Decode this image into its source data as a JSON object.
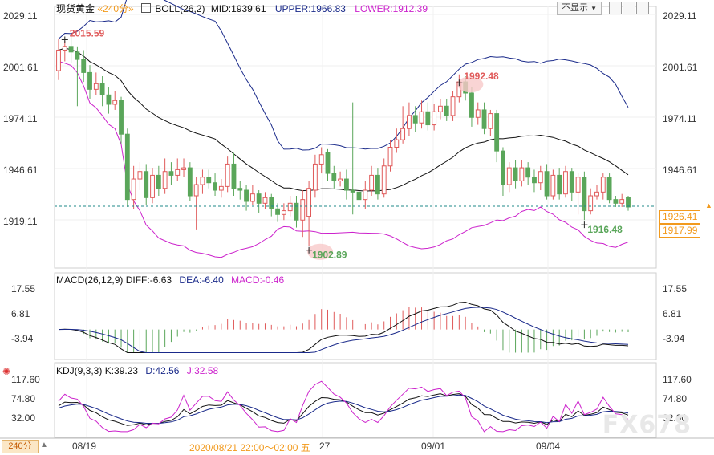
{
  "header": {
    "instrument": "现货黄金",
    "period": "«240分»",
    "boll_label": "BOLL(26,2)",
    "mid": "MID:1939.61",
    "upper": "UPPER:1966.83",
    "lower": "LOWER:1912.39",
    "restore_button": "不显示"
  },
  "macd_header": {
    "name": "MACD(26,12,9)",
    "diff": "DIFF:-6.63",
    "dea": "DEA:-6.40",
    "macd": "MACD:-0.46"
  },
  "kdj_header": {
    "name": "KDJ(9,3,3)",
    "k": "K:39.23",
    "d": "D:42.56",
    "j": "J:32.58"
  },
  "footer": {
    "period_button": "240分",
    "date_1": "08/19",
    "hover_time": "2020/08/21 22:00～02:00 五",
    "date_2": "27",
    "date_3": "09/01",
    "date_4": "09/04"
  },
  "price_axis": [
    "2029.11",
    "2001.61",
    "1974.11",
    "1946.61",
    "1919.11"
  ],
  "price_tags": {
    "current": "1926.41",
    "lower_band": "1917.99"
  },
  "macd_axis": [
    "17.55",
    "6.81",
    "-3.94"
  ],
  "kdj_axis": [
    "117.60",
    "74.80",
    "32.00"
  ],
  "annotations": {
    "high1": "2015.59",
    "high2": "1992.48",
    "low1": "1902.89",
    "low2": "1916.48"
  },
  "watermark": "FX678",
  "colors": {
    "up": "#e05a5a",
    "down": "#5aa65a",
    "mid": "#111111",
    "upper": "#1a2a8a",
    "lower": "#cc22cc",
    "current_line": "#1f8a8a",
    "orange": "#f29a1d"
  },
  "chart_data": {
    "type": "candlestick",
    "y_range": [
      1895,
      2035
    ],
    "candles": [
      [
        1999,
        2010,
        2016,
        1994
      ],
      [
        2010,
        2012,
        2015,
        2004
      ],
      [
        2012,
        2009,
        2018,
        2003
      ],
      [
        2009,
        2005,
        2012,
        1980
      ],
      [
        2005,
        1998,
        2010,
        1993
      ],
      [
        1998,
        1989,
        2002,
        1984
      ],
      [
        1989,
        1992,
        1998,
        1986
      ],
      [
        1992,
        1986,
        1996,
        1980
      ],
      [
        1986,
        1981,
        1990,
        1976
      ],
      [
        1981,
        1983,
        1988,
        1978
      ],
      [
        1983,
        1965,
        1985,
        1960
      ],
      [
        1965,
        1930,
        1968,
        1926
      ],
      [
        1930,
        1941,
        1948,
        1925
      ],
      [
        1941,
        1945,
        1950,
        1935
      ],
      [
        1945,
        1931,
        1949,
        1927
      ],
      [
        1931,
        1943,
        1947,
        1928
      ],
      [
        1943,
        1936,
        1948,
        1932
      ],
      [
        1936,
        1945,
        1952,
        1933
      ],
      [
        1945,
        1943,
        1950,
        1938
      ],
      [
        1943,
        1946,
        1952,
        1940
      ],
      [
        1946,
        1947,
        1952,
        1942
      ],
      [
        1947,
        1932,
        1950,
        1929
      ],
      [
        1932,
        1938,
        1942,
        1914
      ],
      [
        1938,
        1942,
        1946,
        1933
      ],
      [
        1942,
        1939,
        1946,
        1936
      ],
      [
        1939,
        1935,
        1944,
        1932
      ],
      [
        1935,
        1937,
        1941,
        1931
      ],
      [
        1937,
        1949,
        1953,
        1934
      ],
      [
        1949,
        1936,
        1955,
        1932
      ],
      [
        1936,
        1935,
        1940,
        1930
      ],
      [
        1935,
        1929,
        1938,
        1924
      ],
      [
        1929,
        1933,
        1938,
        1927
      ],
      [
        1933,
        1928,
        1935,
        1923
      ],
      [
        1928,
        1931,
        1934,
        1925
      ],
      [
        1931,
        1925,
        1933,
        1921
      ],
      [
        1925,
        1922,
        1928,
        1918
      ],
      [
        1922,
        1924,
        1928,
        1919
      ],
      [
        1924,
        1928,
        1932,
        1921
      ],
      [
        1928,
        1919,
        1932,
        1915
      ],
      [
        1919,
        1930,
        1935,
        1910
      ],
      [
        1921,
        1936,
        1940,
        1905
      ],
      [
        1935,
        1949,
        1954,
        1931
      ],
      [
        1949,
        1954,
        1958,
        1944
      ],
      [
        1955,
        1944,
        1957,
        1940
      ],
      [
        1944,
        1940,
        1948,
        1936
      ],
      [
        1940,
        1941,
        1945,
        1937
      ],
      [
        1941,
        1935,
        1946,
        1930
      ],
      [
        1935,
        1934,
        1982,
        1922
      ],
      [
        1934,
        1930,
        1938,
        1915
      ],
      [
        1930,
        1935,
        1940,
        1925
      ],
      [
        1935,
        1943,
        1948,
        1932
      ],
      [
        1943,
        1933,
        1947,
        1930
      ],
      [
        1933,
        1948,
        1952,
        1931
      ],
      [
        1948,
        1958,
        1962,
        1945
      ],
      [
        1958,
        1962,
        1968,
        1955
      ],
      [
        1962,
        1968,
        1980,
        1960
      ],
      [
        1968,
        1975,
        1982,
        1964
      ],
      [
        1975,
        1971,
        1980,
        1966
      ],
      [
        1971,
        1977,
        1983,
        1968
      ],
      [
        1977,
        1970,
        1982,
        1967
      ],
      [
        1970,
        1977,
        1981,
        1967
      ],
      [
        1977,
        1980,
        1984,
        1973
      ],
      [
        1980,
        1975,
        1984,
        1972
      ],
      [
        1975,
        1985,
        1988,
        1972
      ],
      [
        1985,
        1993,
        1997,
        1982
      ],
      [
        1993,
        1987,
        1996,
        1983
      ],
      [
        1987,
        1974,
        1990,
        1969
      ],
      [
        1974,
        1978,
        1982,
        1970
      ],
      [
        1978,
        1968,
        1982,
        1965
      ],
      [
        1968,
        1976,
        1978,
        1964
      ],
      [
        1976,
        1956,
        1978,
        1950
      ],
      [
        1956,
        1938,
        1958,
        1932
      ],
      [
        1938,
        1947,
        1950,
        1934
      ],
      [
        1947,
        1940,
        1951,
        1936
      ],
      [
        1940,
        1947,
        1951,
        1937
      ],
      [
        1947,
        1942,
        1950,
        1938
      ],
      [
        1942,
        1939,
        1946,
        1934
      ],
      [
        1939,
        1945,
        1948,
        1935
      ],
      [
        1945,
        1932,
        1949,
        1930
      ],
      [
        1932,
        1943,
        1946,
        1930
      ],
      [
        1943,
        1933,
        1947,
        1930
      ],
      [
        1933,
        1945,
        1948,
        1931
      ],
      [
        1945,
        1934,
        1947,
        1929
      ],
      [
        1934,
        1942,
        1944,
        1922
      ],
      [
        1942,
        1924,
        1945,
        1919
      ],
      [
        1924,
        1932,
        1936,
        1922
      ],
      [
        1932,
        1934,
        1938,
        1930
      ],
      [
        1934,
        1942,
        1944,
        1930
      ],
      [
        1942,
        1930,
        1944,
        1928
      ],
      [
        1930,
        1928,
        1932,
        1926
      ],
      [
        1928,
        1930,
        1933,
        1926
      ],
      [
        1931,
        1926,
        1932,
        1924
      ]
    ],
    "macd_range": [
      -10.5,
      18.5
    ],
    "kdj_range": [
      10,
      125
    ],
    "legend": [
      "MID",
      "UPPER",
      "LOWER",
      "DIFF",
      "DEA",
      "MACD",
      "K",
      "D",
      "J"
    ]
  }
}
